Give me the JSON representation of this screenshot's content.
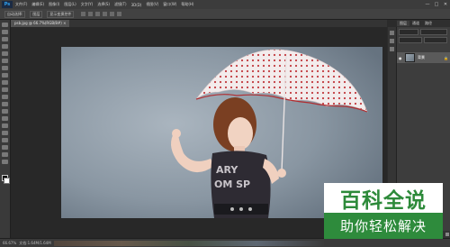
{
  "menubar": {
    "logo": "Ps",
    "items": [
      "文件(F)",
      "编辑(E)",
      "图像(I)",
      "图层(L)",
      "文字(Y)",
      "选择(S)",
      "滤镜(T)",
      "3D(D)",
      "视图(V)",
      "窗口(W)",
      "帮助(H)"
    ],
    "window_controls": [
      "—",
      "□",
      "✕"
    ]
  },
  "options_bar": {
    "items": [
      "自动选择:",
      "图层",
      "显示变换控件"
    ]
  },
  "document": {
    "tab_title": "psb.jpg @ 66.7%(RGB/8#) ×"
  },
  "panel": {
    "tabs": [
      "图层",
      "通道",
      "路径"
    ],
    "layer_name": "背景",
    "layer_lock": "🔒"
  },
  "status": {
    "zoom": "66.67%",
    "doc_info": "文档:1.64M/1.64M"
  },
  "watermark": {
    "title": "百科全说",
    "subtitle": "助你轻松解决"
  },
  "colors": {
    "accent_green": "#2e8b3c",
    "ps_blue": "#2fa3f2"
  }
}
